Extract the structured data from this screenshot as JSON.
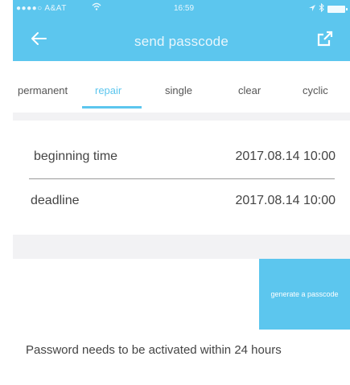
{
  "status_bar": {
    "carrier": "●●●●○ A&AT",
    "time": "16:59"
  },
  "navbar": {
    "title": "send passcode"
  },
  "tabs": [
    {
      "label": "permanent",
      "active": false
    },
    {
      "label": "repair",
      "active": true
    },
    {
      "label": "single",
      "active": false
    },
    {
      "label": "clear",
      "active": false
    },
    {
      "label": "cyclic",
      "active": false
    }
  ],
  "times": {
    "beginning_label": "beginning time",
    "beginning_value": "2017.08.14 10:00",
    "deadline_label": "deadline",
    "deadline_value": "2017.08.14 10:00"
  },
  "generate_button": "generate a passcode",
  "note": "Password needs to be activated within 24 hours",
  "colors": {
    "accent": "#5cc6ee",
    "background": "#f2f2f4"
  },
  "icons": {
    "back": "arrow-left-icon",
    "share": "share-icon",
    "wifi": "wifi-icon",
    "bluetooth": "bluetooth-icon",
    "battery": "battery-icon"
  }
}
